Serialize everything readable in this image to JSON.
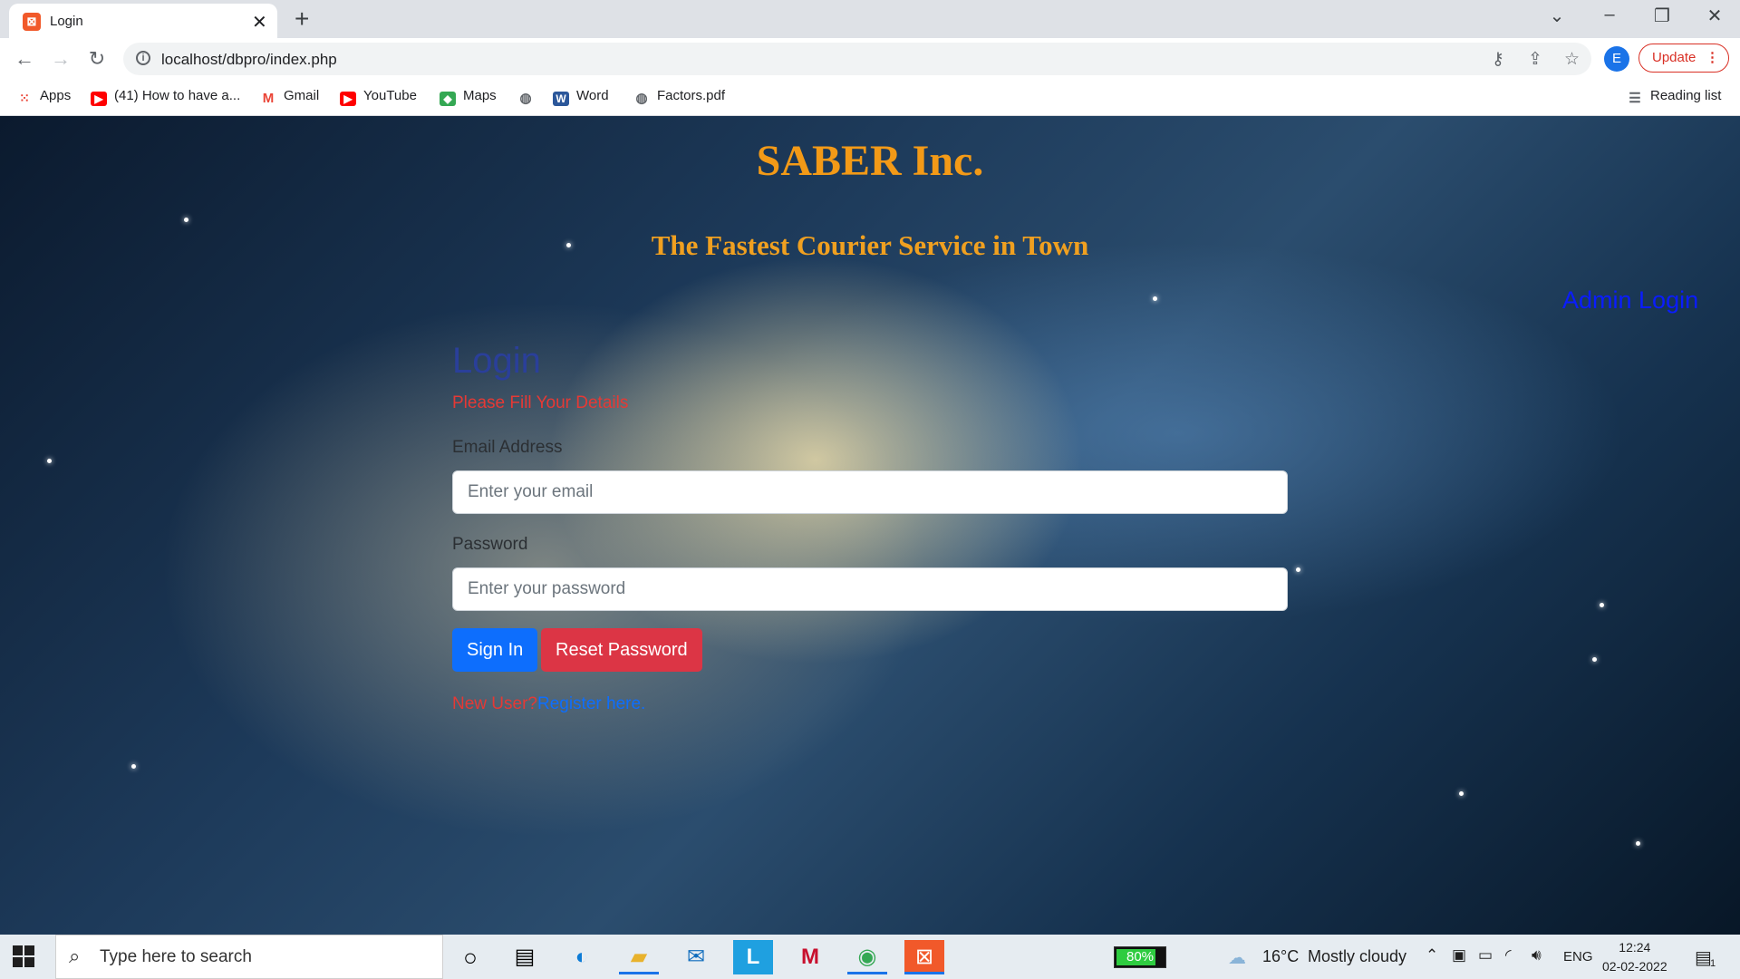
{
  "browser": {
    "tab_title": "Login",
    "url": "localhost/dbpro/index.php",
    "profile_initial": "E",
    "update_label": "Update"
  },
  "bookmarks": {
    "items": [
      "Apps",
      "(41) How to have a...",
      "Gmail",
      "YouTube",
      "Maps",
      "Word",
      "Factors.pdf"
    ],
    "reading_list": "Reading list"
  },
  "page": {
    "site_title": "SABER Inc.",
    "site_subtitle": "The Fastest Courier Service in Town",
    "admin_login": "Admin Login",
    "login_heading": "Login",
    "login_subtitle": "Please Fill Your Details",
    "email_label": "Email Address",
    "email_placeholder": "Enter your email",
    "password_label": "Password",
    "password_placeholder": "Enter your password",
    "signin_button": "Sign In",
    "reset_button": "Reset Password",
    "new_user_text": "New User?",
    "register_link": "Register here."
  },
  "taskbar": {
    "search_placeholder": "Type here to search",
    "battery_percent": 80,
    "battery_label": "80%",
    "weather_temp": "16°C",
    "weather_text": "Mostly cloudy",
    "language": "ENG",
    "time": "12:24",
    "date": "02-02-2022",
    "notification_count": "1"
  },
  "colors": {
    "title_orange": "#f39a17",
    "admin_blue": "#0a1cff",
    "login_blue": "#2a3f9a",
    "error_red": "#e53935",
    "primary": "#0d6efd",
    "danger": "#dc3545"
  }
}
